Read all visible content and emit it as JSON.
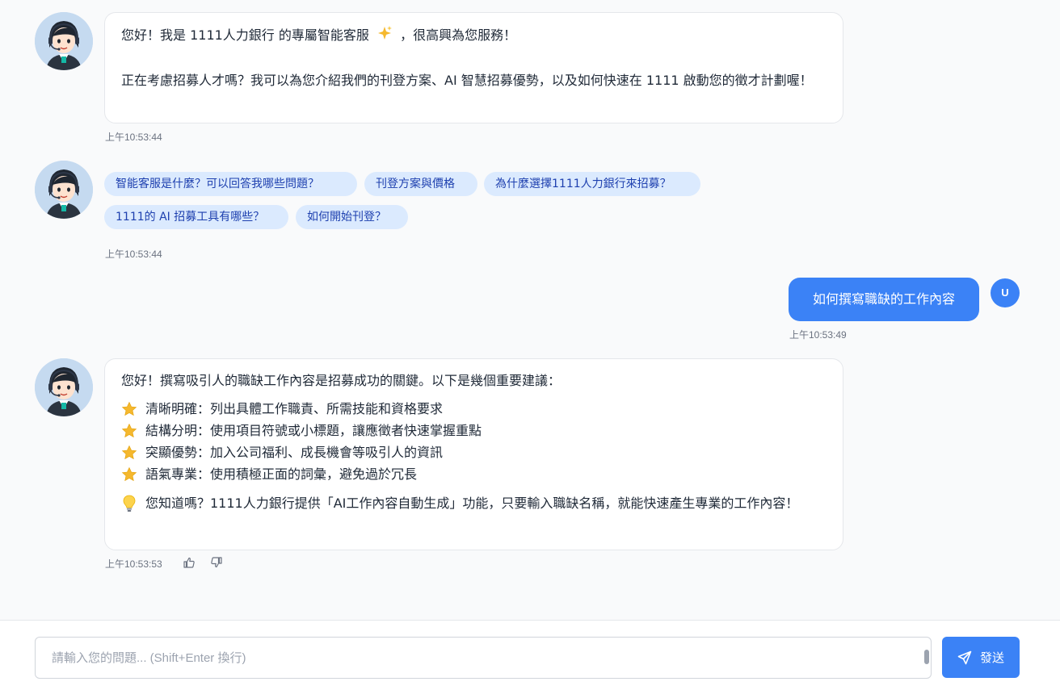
{
  "messages": {
    "greeting": {
      "line1_before": "您好！我是 1111人力銀行 的專屬智能客服",
      "line1_after": "，很高興為您服務！",
      "line2": "正在考慮招募人才嗎？我可以為您介紹我們的刊登方案、AI 智慧招募優勢，以及如何快速在 1111 啟動您的徵才計劃喔！",
      "time": "上午10:53:44"
    },
    "suggestions": {
      "chips": [
        "智能客服是什麼？可以回答我哪些問題？",
        "刊登方案與價格",
        "為什麼選擇1111人力銀行來招募？",
        "1111的 AI 招募工具有哪些？",
        "如何開始刊登？"
      ],
      "time": "上午10:53:44"
    },
    "user_message": {
      "text": "如何撰寫職缺的工作內容",
      "time": "上午10:53:49",
      "avatar_letter": "U"
    },
    "answer": {
      "intro": "您好！撰寫吸引人的職缺工作內容是招募成功的關鍵。以下是幾個重要建議：",
      "tips": [
        "清晰明確：列出具體工作職責、所需技能和資格要求",
        "結構分明：使用項目符號或小標題，讓應徵者快速掌握重點",
        "突顯優勢：加入公司福利、成長機會等吸引人的資訊",
        "語氣專業：使用積極正面的詞彙，避免過於冗長"
      ],
      "tip_icon": "star-icon",
      "note": "您知道嗎？1111人力銀行提供「AI工作內容自動生成」功能，只要輸入職缺名稱，就能快速產生專業的工作內容！",
      "note_icon": "lightbulb-icon",
      "time": "上午10:53:53"
    }
  },
  "input": {
    "placeholder": "請輸入您的問題... (Shift+Enter 換行)",
    "send_label": "發送"
  },
  "colors": {
    "accent": "#3b82f6",
    "chip_bg": "#dbeafe",
    "chip_text": "#1e40af"
  }
}
